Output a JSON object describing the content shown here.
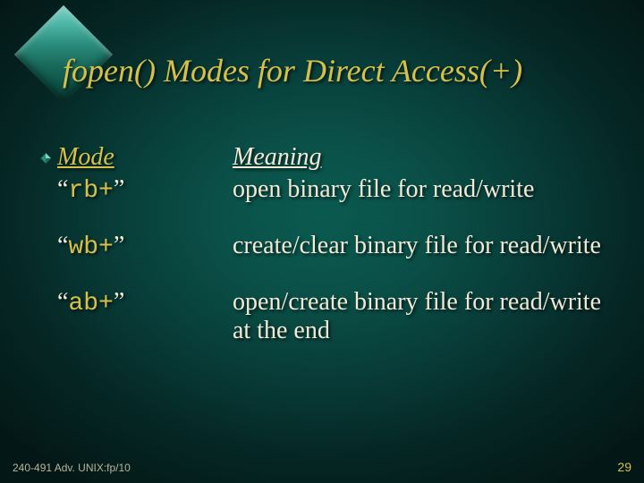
{
  "title": "fopen() Modes for Direct Access(+)",
  "headers": {
    "mode": "Mode",
    "meaning": "Meaning"
  },
  "quote": {
    "open": "“",
    "close": "”"
  },
  "rows": [
    {
      "mode": "rb+",
      "meaning": "open binary file for read/write"
    },
    {
      "mode": "wb+",
      "meaning": "create/clear binary file for read/write"
    },
    {
      "mode": "ab+",
      "meaning": "open/create binary file for read/write at the end"
    }
  ],
  "footer": {
    "left": "240-491 Adv. UNIX:fp/10",
    "right": "29"
  }
}
